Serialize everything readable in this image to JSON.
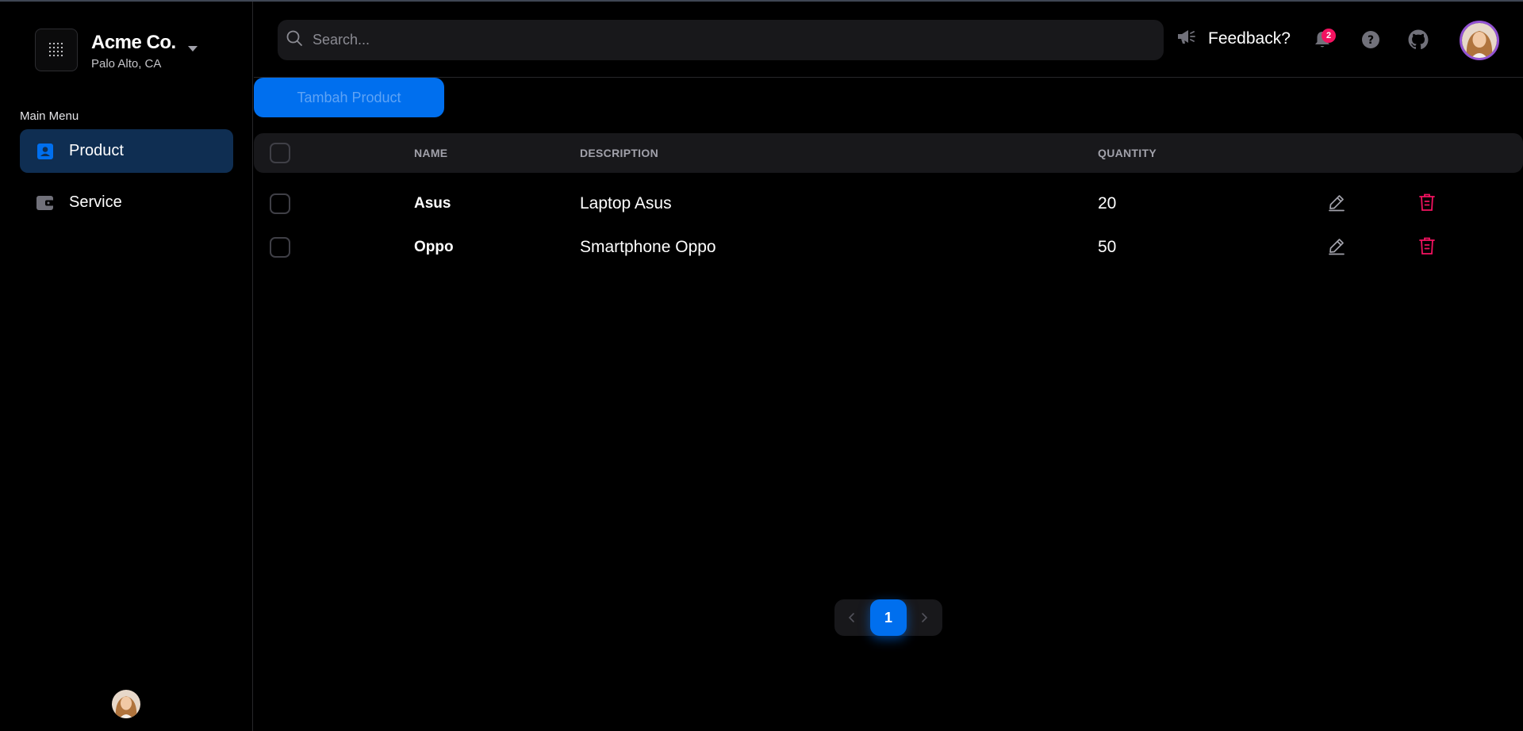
{
  "org": {
    "name": "Acme Co.",
    "location": "Palo Alto, CA"
  },
  "sidebar": {
    "heading": "Main Menu",
    "items": [
      {
        "label": "Product",
        "icon": "contact-card-icon",
        "active": true
      },
      {
        "label": "Service",
        "icon": "wallet-icon",
        "active": false
      }
    ]
  },
  "header": {
    "search_placeholder": "Search...",
    "feedback_label": "Feedback?",
    "notification_count": "2"
  },
  "main": {
    "add_button_label": "Tambah Product",
    "table": {
      "columns": [
        "NAME",
        "DESCRIPTION",
        "QUANTITY"
      ],
      "rows": [
        {
          "name": "Asus",
          "description": "Laptop Asus",
          "quantity": "20"
        },
        {
          "name": "Oppo",
          "description": "Smartphone Oppo",
          "quantity": "50"
        }
      ]
    },
    "pagination": {
      "current_page": "1"
    }
  },
  "colors": {
    "primary": "#006fee",
    "danger": "#f31260",
    "active_nav_bg": "#0f2e52",
    "surface": "#18181b"
  }
}
